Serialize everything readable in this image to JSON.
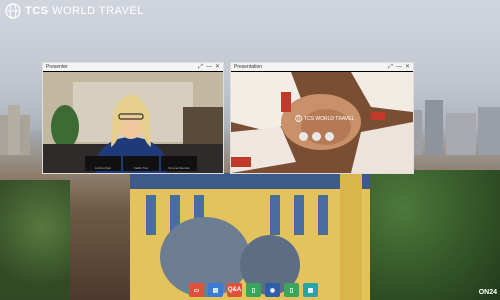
{
  "brand": {
    "name_bold": "TCS",
    "name_light": "WORLD TRAVEL"
  },
  "presenter_panel": {
    "title": "Presenter",
    "names": [
      "Ambra Zyler",
      "Kaitlin Tow",
      "Simone Mendes"
    ]
  },
  "presentation_panel": {
    "title": "Presentation",
    "slide_brand": "TCS WORLD TRAVEL"
  },
  "toolbar": [
    {
      "name": "slides-button",
      "label": "",
      "color": "#e2503a"
    },
    {
      "name": "chat-button",
      "label": "",
      "color": "#3a7bd5"
    },
    {
      "name": "qa-button",
      "label": "Q&A",
      "color": "#e2503a"
    },
    {
      "name": "notes-button",
      "label": "",
      "color": "#3aa55d"
    },
    {
      "name": "user-button",
      "label": "",
      "color": "#2f5fa8"
    },
    {
      "name": "resources-button",
      "label": "",
      "color": "#3aa55d"
    },
    {
      "name": "survey-button",
      "label": "",
      "color": "#28a4a4"
    }
  ],
  "watermark": "ON24"
}
